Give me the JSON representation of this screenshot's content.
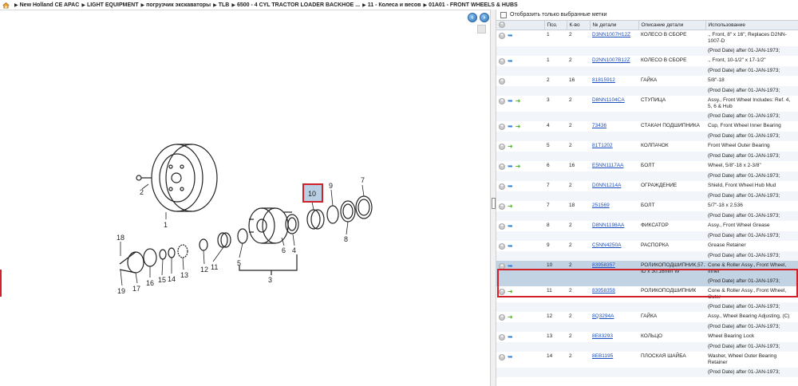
{
  "breadcrumb": [
    "New Holland CE APAC",
    "LIGHT EQUIPMENT",
    "погрузчик экскаваторы",
    "TLB",
    "6500 - 4 CYL TRACTOR LOADER BACKHOE ...",
    "11 - Колеса и весов",
    "01A01 - FRONT WHEELS & HUBS"
  ],
  "diagram": {
    "callouts": [
      "1",
      "2",
      "3",
      "4",
      "5",
      "6",
      "7",
      "8",
      "9",
      "10",
      "11",
      "12",
      "13",
      "14",
      "15",
      "16",
      "17",
      "18",
      "19"
    ],
    "highlight_label": "10"
  },
  "filter": {
    "label": "Отобразить только выбранные метки"
  },
  "table": {
    "headers": [
      "",
      "Поз.",
      "К-во",
      "№ детали",
      "Описание детали",
      "Использование"
    ],
    "rows": [
      {
        "pos": "1",
        "qty": "2",
        "part": "D3NN1007H12Z",
        "desc": "КОЛЕСО В СБОРЕ",
        "use": "., Front, 8\" x 16\", Replaces D2NN-1007-D",
        "use2": "(Prod Date) after 01-JAN-1973;",
        "icons": [
          "plus",
          "blue"
        ]
      },
      {
        "pos": "1",
        "qty": "2",
        "part": "D2NN1007B12Z",
        "desc": "КОЛЕСО В СБОРЕ",
        "use": "., Front, 10-1/2\" x 17-1/2\"",
        "use2": "(Prod Date) after 01-JAN-1973;",
        "icons": [
          "plus",
          "blue"
        ]
      },
      {
        "pos": "2",
        "qty": "16",
        "part": "81815912",
        "desc": "ГАЙКА",
        "use": "5/8\"-18",
        "use2": "(Prod Date) after 01-JAN-1973;",
        "icons": [
          "plus"
        ]
      },
      {
        "pos": "3",
        "qty": "2",
        "part": "D8NN1104CA",
        "desc": "СТУПИЦА",
        "use": "Assy., Front Wheel Includes: Ref. 4, 5, 6 & Hub",
        "use2": "(Prod Date) after 01-JAN-1973;",
        "icons": [
          "plus",
          "blue",
          "green"
        ]
      },
      {
        "pos": "4",
        "qty": "2",
        "part": "73436",
        "desc": "СТАКАН ПОДШИПНИКА",
        "use": "Cup, Front Wheel Inner Bearing",
        "use2": "(Prod Date) after 01-JAN-1973;",
        "icons": [
          "plus",
          "blue",
          "green"
        ]
      },
      {
        "pos": "5",
        "qty": "2",
        "part": "81T1202",
        "desc": "КОЛПАЧОК",
        "use": "Front Wheel Outer Bearing",
        "use2": "(Prod Date) after 01-JAN-1973;",
        "icons": [
          "plus",
          "green"
        ]
      },
      {
        "pos": "6",
        "qty": "16",
        "part": "E5NN1117AA",
        "desc": "БОЛТ",
        "use": "Wheel, 5/8\"-18 x 2-3/8\"",
        "use2": "(Prod Date) after 01-JAN-1973;",
        "icons": [
          "plus",
          "blue",
          "green"
        ]
      },
      {
        "pos": "7",
        "qty": "2",
        "part": "D0NN1214A",
        "desc": "ОГРАЖДЕНИЕ",
        "use": "Shield, Front Wheel Hub Mud",
        "use2": "(Prod Date) after 01-JAN-1973;",
        "icons": [
          "plus",
          "blue"
        ]
      },
      {
        "pos": "7",
        "qty": "18",
        "part": "251569",
        "desc": "БОЛТ",
        "use": "5/7\"-18 x 2.536",
        "use2": "(Prod Date) after 01-JAN-1973;",
        "icons": [
          "plus",
          "green"
        ]
      },
      {
        "pos": "8",
        "qty": "2",
        "part": "D8NN1198AA",
        "desc": "ФИКСАТОР",
        "use": "Assy., Front Wheel Grease",
        "use2": "(Prod Date) after 01-JAN-1973;",
        "icons": [
          "plus",
          "blue"
        ]
      },
      {
        "pos": "9",
        "qty": "2",
        "part": "C5NN4250A",
        "desc": "РАСПОРКА",
        "use": "Grease Retainer",
        "use2": "(Prod Date) after 01-JAN-1973;",
        "icons": [
          "plus",
          "blue"
        ]
      },
      {
        "pos": "10",
        "qty": "2",
        "part": "83958357",
        "desc": "РОЛИКОПОДШИПНИК,57.15mm ID x 30.16mm W",
        "use": "Cone & Roller Assy., Front Wheel, Inner",
        "use2": "(Prod Date) after 01-JAN-1973;",
        "icons": [
          "plus",
          "blue"
        ],
        "selected": true
      },
      {
        "pos": "11",
        "qty": "2",
        "part": "83958358",
        "desc": "РОЛИКОПОДШИПНИК",
        "use": "Cone & Roller Assy., Front Wheel, Outer",
        "use2": "(Prod Date) after 01-JAN-1973;",
        "icons": [
          "plus",
          "green"
        ]
      },
      {
        "pos": "12",
        "qty": "2",
        "part": "8Q3294A",
        "desc": "ГАЙКА",
        "use": "Assy., Wheel Bearing Adjusting, (C)",
        "use2": "(Prod Date) after 01-JAN-1973;",
        "icons": [
          "plus",
          "green"
        ]
      },
      {
        "pos": "13",
        "qty": "2",
        "part": "8E83293",
        "desc": "КОЛЬЦО",
        "use": "Wheel Bearing Lock",
        "use2": "(Prod Date) after 01-JAN-1973;",
        "icons": [
          "plus",
          "blue"
        ]
      },
      {
        "pos": "14",
        "qty": "2",
        "part": "8EB1195",
        "desc": "ПЛОСКАЯ ШАЙБА",
        "use": "Washer, Wheel Outer Bearing Retainer",
        "use2": "(Prod Date) after 01-JAN-1973;",
        "icons": [
          "plus",
          "blue"
        ]
      }
    ]
  },
  "colors": {
    "header_bg": "#e9eef4",
    "selected_bg": "#c2d3e4",
    "highlight_red": "#d0212b",
    "link": "#1b4fbf"
  }
}
